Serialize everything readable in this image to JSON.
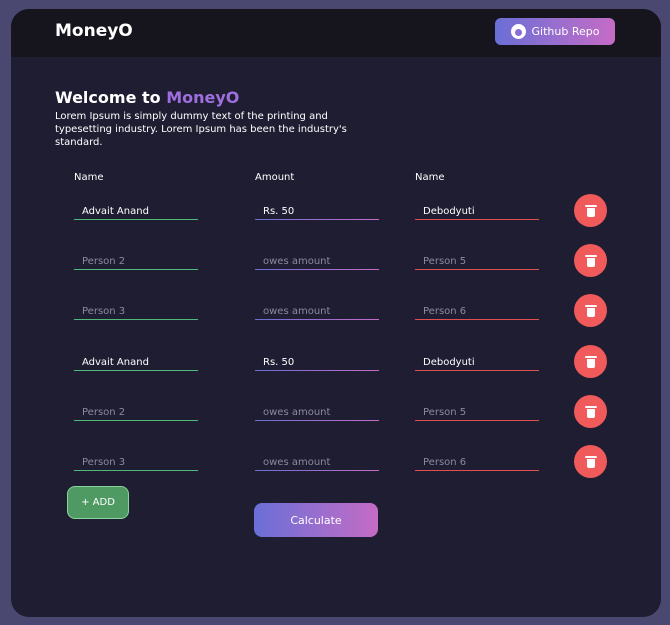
{
  "header": {
    "brand": "MoneyO",
    "github_button": "Github Repo"
  },
  "hero": {
    "welcome_prefix": "Welcome to ",
    "welcome_accent": "MoneyO",
    "description": "Lorem Ipsum is simply dummy text of the printing and typesetting industry. Lorem Ipsum has been the industry's standard."
  },
  "columns": {
    "name1": "Name",
    "amount": "Amount",
    "name2": "Name"
  },
  "rows": [
    {
      "from": {
        "value": "Advait Anand",
        "placeholder": ""
      },
      "amount": {
        "value": "Rs. 50",
        "placeholder": ""
      },
      "to": {
        "value": "Debodyuti",
        "placeholder": ""
      }
    },
    {
      "from": {
        "value": "",
        "placeholder": "Person 2"
      },
      "amount": {
        "value": "",
        "placeholder": "owes amount"
      },
      "to": {
        "value": "",
        "placeholder": "Person 5"
      }
    },
    {
      "from": {
        "value": "",
        "placeholder": "Person 3"
      },
      "amount": {
        "value": "",
        "placeholder": "owes amount"
      },
      "to": {
        "value": "",
        "placeholder": "Person 6"
      }
    },
    {
      "from": {
        "value": "Advait Anand",
        "placeholder": ""
      },
      "amount": {
        "value": "Rs. 50",
        "placeholder": ""
      },
      "to": {
        "value": "Debodyuti",
        "placeholder": ""
      }
    },
    {
      "from": {
        "value": "",
        "placeholder": "Person 2"
      },
      "amount": {
        "value": "",
        "placeholder": "owes amount"
      },
      "to": {
        "value": "",
        "placeholder": "Person 5"
      }
    },
    {
      "from": {
        "value": "",
        "placeholder": "Person 3"
      },
      "amount": {
        "value": "",
        "placeholder": "owes amount"
      },
      "to": {
        "value": "",
        "placeholder": "Person 6"
      }
    }
  ],
  "actions": {
    "add_label": "+ ADD",
    "calculate_label": "Calculate"
  },
  "icons": {
    "github": "github-icon",
    "delete": "trash-icon"
  },
  "colors": {
    "accent": "#9f6fe0",
    "gradient_start": "#6a6fd6",
    "gradient_end": "#c56cc6",
    "green": "#4fb97a",
    "red": "#f05a5a"
  }
}
